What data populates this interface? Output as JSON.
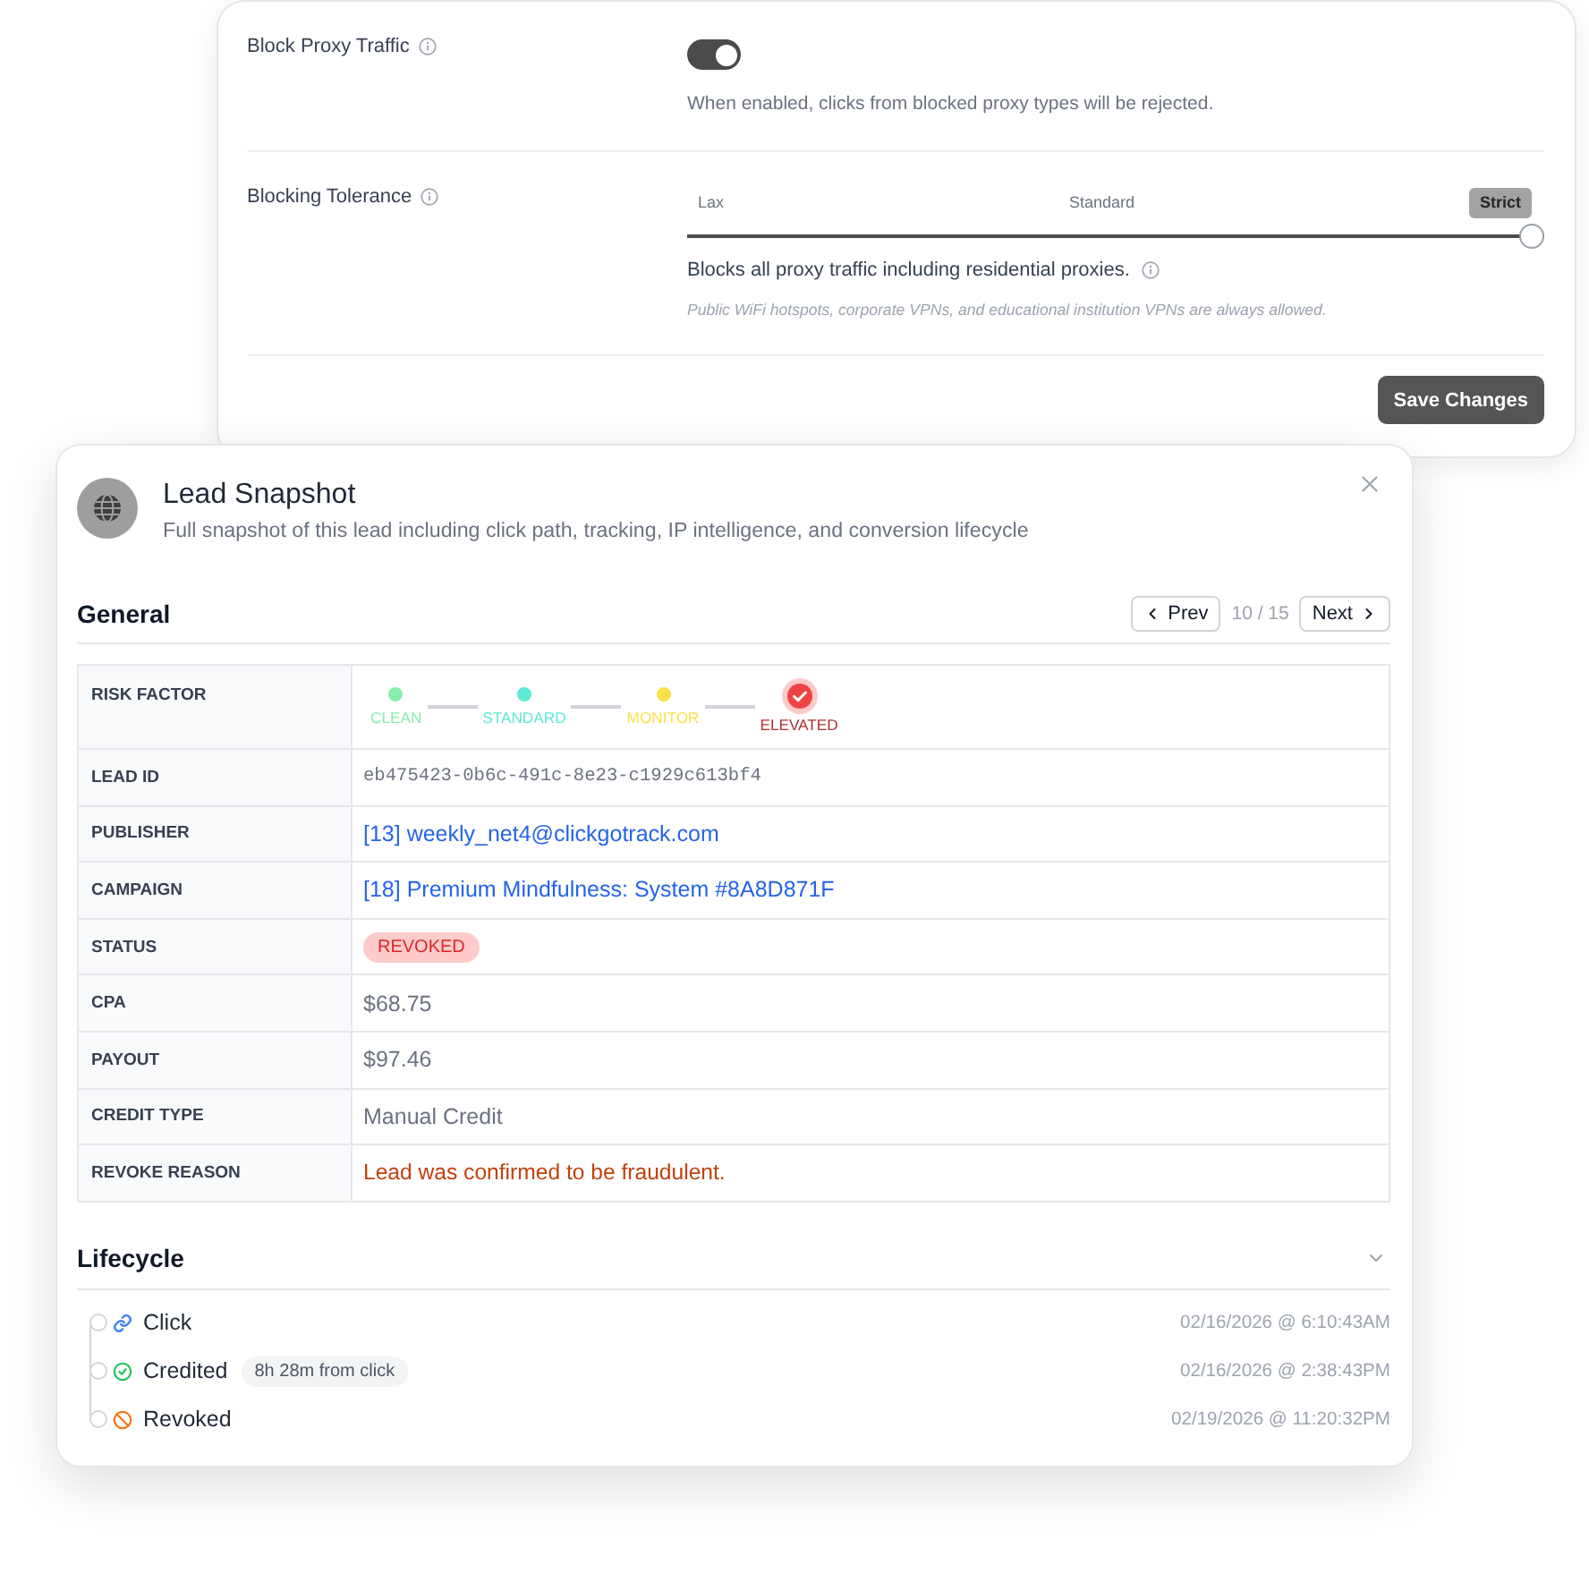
{
  "settings_panel": {
    "rows": [
      {
        "kind": "toggle",
        "label": "Block Proxy Traffic",
        "on": true,
        "description": "When enabled, clicks from blocked proxy types will be rejected."
      },
      {
        "kind": "slider",
        "label": "Blocking Tolerance",
        "stops": [
          {
            "label": "Lax",
            "selected": false
          },
          {
            "label": "Standard",
            "selected": false
          },
          {
            "label": "Strict",
            "selected": true
          }
        ],
        "level": 1,
        "description": "Blocks all proxy traffic including residential proxies.",
        "note": "Public WiFi hotspots, corporate VPNs, and educational institution VPNs are always allowed."
      }
    ],
    "save_button": "Save Changes"
  },
  "lead_snapshot": {
    "title": "Lead Snapshot",
    "subtitle": "Full snapshot of this lead including click path, tracking, IP intelligence, and conversion lifecycle",
    "general": {
      "heading": "General",
      "prev_button": "Prev",
      "pager": "10 / 15",
      "next_button": "Next",
      "rows": [
        {
          "kind": "risk",
          "label": "RISK FACTOR",
          "steps": [
            {
              "label": "CLEAN",
              "color": "#86efac",
              "selected": false
            },
            {
              "label": "STANDARD",
              "color": "#5eead4",
              "selected": false
            },
            {
              "label": "MONITOR",
              "color": "#fde047",
              "selected": false
            },
            {
              "label": "ELEVATED",
              "color": "#ef4444",
              "selected": true
            }
          ]
        },
        {
          "kind": "mono",
          "label": "LEAD ID",
          "value": "eb475423-0b6c-491c-8e23-c1929c613bf4"
        },
        {
          "kind": "link",
          "label": "PUBLISHER",
          "value": "[13] weekly_net4@clickgotrack.com"
        },
        {
          "kind": "link",
          "label": "CAMPAIGN",
          "value": "[18] Premium Mindfulness: System #8A8D871F"
        },
        {
          "kind": "badge",
          "label": "STATUS",
          "value": "REVOKED"
        },
        {
          "kind": "text",
          "label": "CPA",
          "value": "$68.75"
        },
        {
          "kind": "text",
          "label": "PAYOUT",
          "value": "$97.46"
        },
        {
          "kind": "text",
          "label": "CREDIT TYPE",
          "value": "Manual Credit"
        },
        {
          "kind": "alert",
          "label": "REVOKE REASON",
          "value": "Lead was confirmed to be fraudulent."
        }
      ]
    },
    "lifecycle": {
      "heading": "Lifecycle",
      "expanded": true,
      "events": [
        {
          "kind": "click",
          "label": "Click",
          "timestamp": "02/16/2026 @ 6:10:43AM"
        },
        {
          "kind": "credited",
          "label": "Credited",
          "badge": "8h 28m from click",
          "timestamp": "02/16/2026 @ 2:38:43PM"
        },
        {
          "kind": "revoked",
          "label": "Revoked",
          "timestamp": "02/19/2026 @ 11:20:32PM"
        }
      ]
    }
  }
}
